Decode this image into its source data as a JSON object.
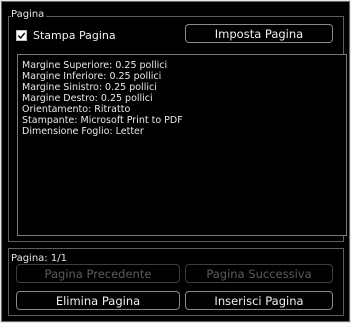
{
  "page_group": {
    "title": "Pagina",
    "print_page_checkbox": {
      "label": "Stampa Pagina",
      "checked": true
    },
    "setup_page_button": "Imposta Pagina",
    "info_lines": [
      "Margine Superiore: 0.25 pollici",
      "Margine Inferiore: 0.25 pollici",
      "Margine Sinistro: 0.25 pollici",
      "Margine Destro: 0.25 pollici",
      "Orientamento: Ritratto",
      "Stampante: Microsoft Print to PDF",
      "Dimensione Foglio: Letter"
    ]
  },
  "pagination": {
    "label": "Pagina: 1/1",
    "previous_button": "Pagina Precedente",
    "next_button": "Pagina Successiva",
    "delete_button": "Elimina Pagina",
    "insert_button": "Inserisci Pagina"
  }
}
